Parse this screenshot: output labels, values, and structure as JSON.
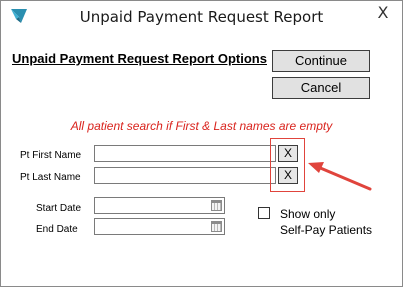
{
  "window": {
    "title": "Unpaid Payment Request Report",
    "close_glyph": "X",
    "app_icon": "app-logo-icon"
  },
  "header": {
    "heading": "Unpaid Payment Request Report Options",
    "continue_label": "Continue",
    "cancel_label": "Cancel"
  },
  "hint": "All patient search if First & Last names are empty",
  "fields": {
    "first_name_label": "Pt First Name",
    "first_name_value": "",
    "last_name_label": "Pt Last Name",
    "last_name_value": "",
    "clear_glyph": "X",
    "start_date_label": "Start Date",
    "start_date_value": "",
    "end_date_label": "End Date",
    "end_date_value": "",
    "calendar_icon": "calendar-icon"
  },
  "selfpay": {
    "line1": "Show only",
    "line2": "Self-Pay Patients",
    "checked": false
  },
  "annotation": {
    "box_color": "#e0443c",
    "arrow_color": "#e0443c"
  },
  "colors": {
    "hint_color": "#d9231d",
    "button_face": "#e1e1e1",
    "icon_teal": "#2a8fb0"
  }
}
